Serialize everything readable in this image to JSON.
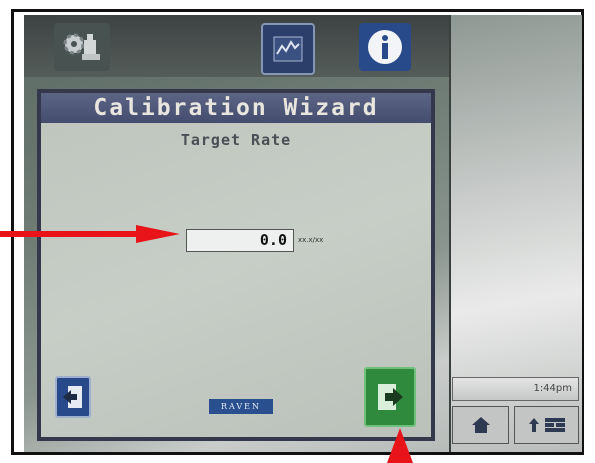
{
  "wizard": {
    "title": "Calibration Wizard",
    "step_title": "Target Rate",
    "target_rate_value": "0.0",
    "rate_units": "xx.x/xx"
  },
  "toolbar": {
    "icons": [
      "gear-icon",
      "gauge-icon",
      "info-icon"
    ]
  },
  "branding": {
    "logo_text": "RAVEN"
  },
  "status": {
    "time": "1:44pm"
  },
  "colors": {
    "callout_arrow": "#e8141a",
    "title_bar": "#4b5474",
    "next_button": "#2f8a3e",
    "back_button": "#294a8a"
  }
}
